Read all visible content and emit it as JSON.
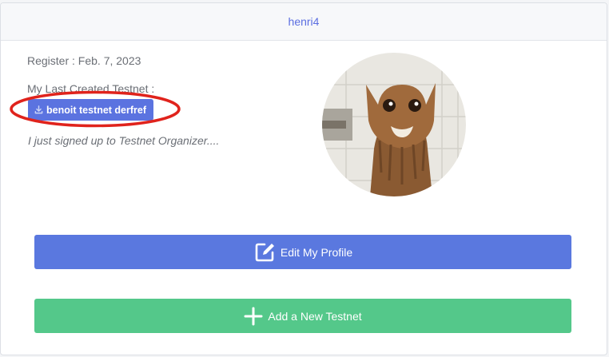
{
  "header": {
    "username": "henri4"
  },
  "profile": {
    "register_text": "Register : Feb. 7, 2023",
    "last_testnet_label": "My Last Created Testnet :",
    "last_testnet_name": "benoit testnet derfref",
    "bio": "I just signed up to Testnet Organizer...."
  },
  "actions": {
    "edit_label": "Edit My Profile",
    "add_label": "Add a New Testnet"
  },
  "icons": {
    "badge": "download-icon",
    "edit": "edit-square-icon",
    "add": "plus-icon"
  },
  "colors": {
    "accent": "#5b6ee1",
    "edit_button": "#5a78df",
    "add_button": "#54c88a",
    "highlight": "#e0231c"
  }
}
